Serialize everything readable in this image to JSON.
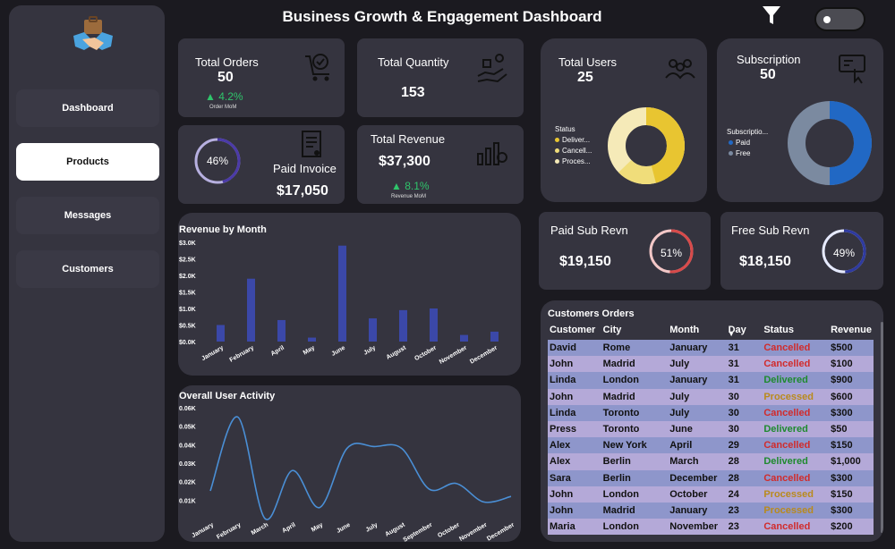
{
  "header": {
    "title": "Business Growth & Engagement Dashboard"
  },
  "sidebar": {
    "items": [
      {
        "label": "Dashboard",
        "active": false
      },
      {
        "label": "Products",
        "active": true
      },
      {
        "label": "Messages",
        "active": false
      },
      {
        "label": "Customers",
        "active": false
      }
    ]
  },
  "kpis": {
    "total_orders": {
      "label": "Total Orders",
      "value": "50",
      "change": "4.2%",
      "change_label": "Order MoM"
    },
    "total_quantity": {
      "label": "Total Quantity",
      "value": "153"
    },
    "paid_invoice": {
      "label": "Paid Invoice",
      "value": "$17,050",
      "percent": "46%",
      "fraction": 0.46
    },
    "total_revenue": {
      "label": "Total Revenue",
      "value": "$37,300",
      "change": "8.1%",
      "change_label": "Revenue MoM"
    },
    "total_users": {
      "label": "Total Users",
      "value": "25",
      "legend_title": "Status",
      "legend": [
        "Deliver...",
        "Cancell...",
        "Proces..."
      ]
    },
    "subscription": {
      "label": "Subscription",
      "value": "50",
      "legend_title": "Subscriptio...",
      "legend": [
        "Paid",
        "Free"
      ]
    },
    "paid_sub": {
      "label": "Paid Sub Revn",
      "value": "$19,150",
      "percent": "51%",
      "fraction": 0.51
    },
    "free_sub": {
      "label": "Free Sub Revn",
      "value": "$18,150",
      "percent": "49%",
      "fraction": 0.49
    }
  },
  "colors": {
    "bar": "#3b48a8",
    "line": "#4a8fd6",
    "paid": "#2168c4",
    "free": "#7b8aa0",
    "gold1": "#e8c531",
    "gold2": "#f0dd7a",
    "gold3": "#f5eab8",
    "up": "#2fc46b"
  },
  "chart_data": [
    {
      "type": "bar",
      "title": "Revenue by Month",
      "categories": [
        "January",
        "February",
        "April",
        "May",
        "June",
        "July",
        "August",
        "October",
        "November",
        "December"
      ],
      "values": [
        500,
        1900,
        650,
        120,
        2900,
        700,
        950,
        1000,
        200,
        300
      ],
      "ylim": [
        0,
        3000
      ],
      "yticks": [
        "$0.0K",
        "$0.5K",
        "$1.0K",
        "$1.5K",
        "$2.0K",
        "$2.5K",
        "$3.0K"
      ]
    },
    {
      "type": "line",
      "title": "Overall User Activity",
      "categories": [
        "January",
        "February",
        "March",
        "April",
        "May",
        "June",
        "July",
        "August",
        "September",
        "October",
        "November",
        "December"
      ],
      "values": [
        0.015,
        0.055,
        0.0,
        0.026,
        0.006,
        0.038,
        0.039,
        0.038,
        0.016,
        0.019,
        0.009,
        0.012
      ],
      "ylim": [
        0,
        0.06
      ],
      "yticks": [
        "0.01K",
        "0.02K",
        "0.03K",
        "0.04K",
        "0.05K",
        "0.06K"
      ]
    }
  ],
  "orders": {
    "title": "Customers Orders",
    "columns": [
      "Customer",
      "City",
      "Month",
      "Day",
      "Status",
      "Revenue"
    ],
    "rows": [
      [
        "David",
        "Rome",
        "January",
        "31",
        "Cancelled",
        "$500"
      ],
      [
        "John",
        "Madrid",
        "July",
        "31",
        "Cancelled",
        "$100"
      ],
      [
        "Linda",
        "London",
        "January",
        "31",
        "Delivered",
        "$900"
      ],
      [
        "John",
        "Madrid",
        "July",
        "30",
        "Processed",
        "$600"
      ],
      [
        "Linda",
        "Toronto",
        "July",
        "30",
        "Cancelled",
        "$300"
      ],
      [
        "Press",
        "Toronto",
        "June",
        "30",
        "Delivered",
        "$50"
      ],
      [
        "Alex",
        "New York",
        "April",
        "29",
        "Cancelled",
        "$150"
      ],
      [
        "Alex",
        "Berlin",
        "March",
        "28",
        "Delivered",
        "$1,000"
      ],
      [
        "Sara",
        "Berlin",
        "December",
        "28",
        "Cancelled",
        "$300"
      ],
      [
        "John",
        "London",
        "October",
        "24",
        "Processed",
        "$150"
      ],
      [
        "John",
        "Madrid",
        "January",
        "23",
        "Processed",
        "$300"
      ],
      [
        "Maria",
        "London",
        "November",
        "23",
        "Cancelled",
        "$200"
      ]
    ]
  }
}
